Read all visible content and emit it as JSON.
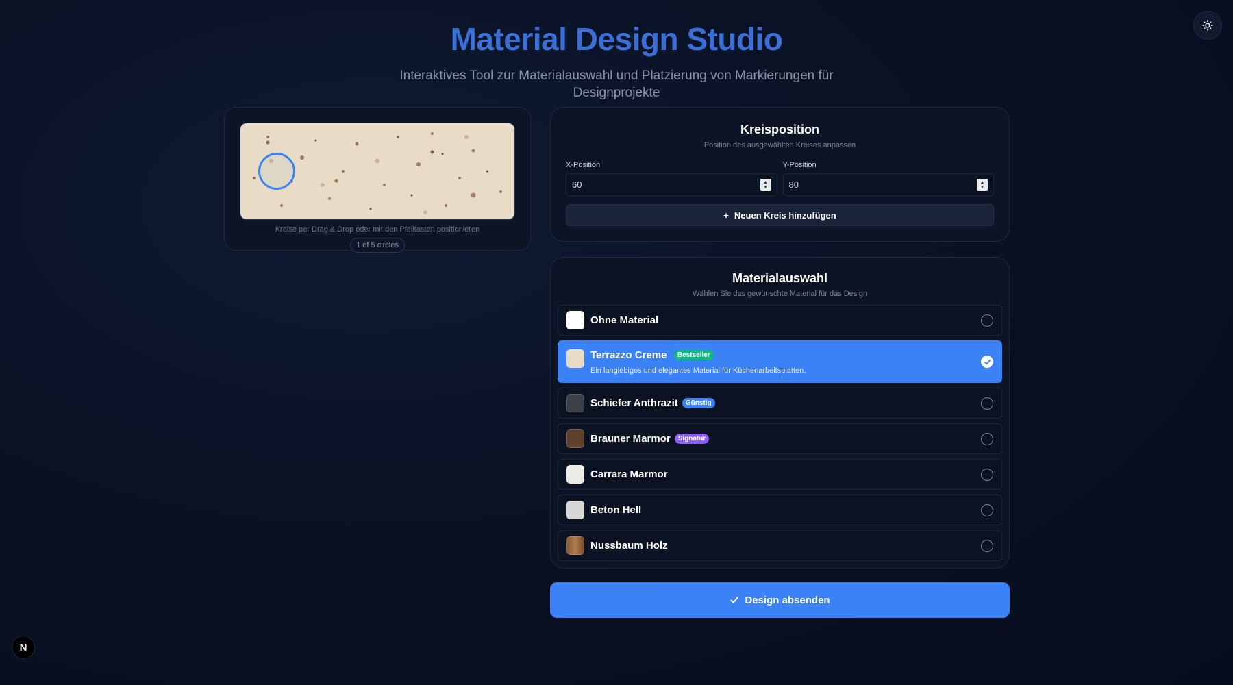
{
  "header": {
    "title": "Material Design Studio",
    "subtitle": "Interaktives Tool zur Materialauswahl und Platzierung von Markierungen für Designprojekte"
  },
  "preview": {
    "hint": "Kreise per Drag & Drop oder mit den Pfeiltasten positionieren",
    "circle_count": "1 of 5 circles"
  },
  "position": {
    "title": "Kreisposition",
    "description": "Position des ausgewählten Kreises anpassen",
    "x_label": "X-Position",
    "x_value": "60",
    "y_label": "Y-Position",
    "y_value": "80",
    "add_button": "Neuen Kreis hinzufügen"
  },
  "materials": {
    "title": "Materialauswahl",
    "description": "Wählen Sie das gewünschte Material für das Design",
    "items": [
      {
        "name": "Ohne Material",
        "badge": "",
        "selected": false
      },
      {
        "name": "Terrazzo Creme",
        "badge": "Bestseller",
        "badge_color": "#10b981",
        "description": "Ein langlebiges und elegantes Material für Küchenarbeitsplatten.",
        "selected": true
      },
      {
        "name": "Schiefer Anthrazit",
        "badge": "Günstig",
        "badge_color": "#3b82f6",
        "selected": false
      },
      {
        "name": "Brauner Marmor",
        "badge": "Signatur",
        "badge_color": "#8b5cf6",
        "selected": false
      },
      {
        "name": "Carrara Marmor",
        "badge": "",
        "selected": false
      },
      {
        "name": "Beton Hell",
        "badge": "",
        "selected": false
      },
      {
        "name": "Nussbaum Holz",
        "badge": "",
        "selected": false
      }
    ]
  },
  "submit_label": "Design absenden",
  "colors": {
    "accent": "#3b82f6",
    "title": "#3b6fd6",
    "background": "#0a1226"
  }
}
